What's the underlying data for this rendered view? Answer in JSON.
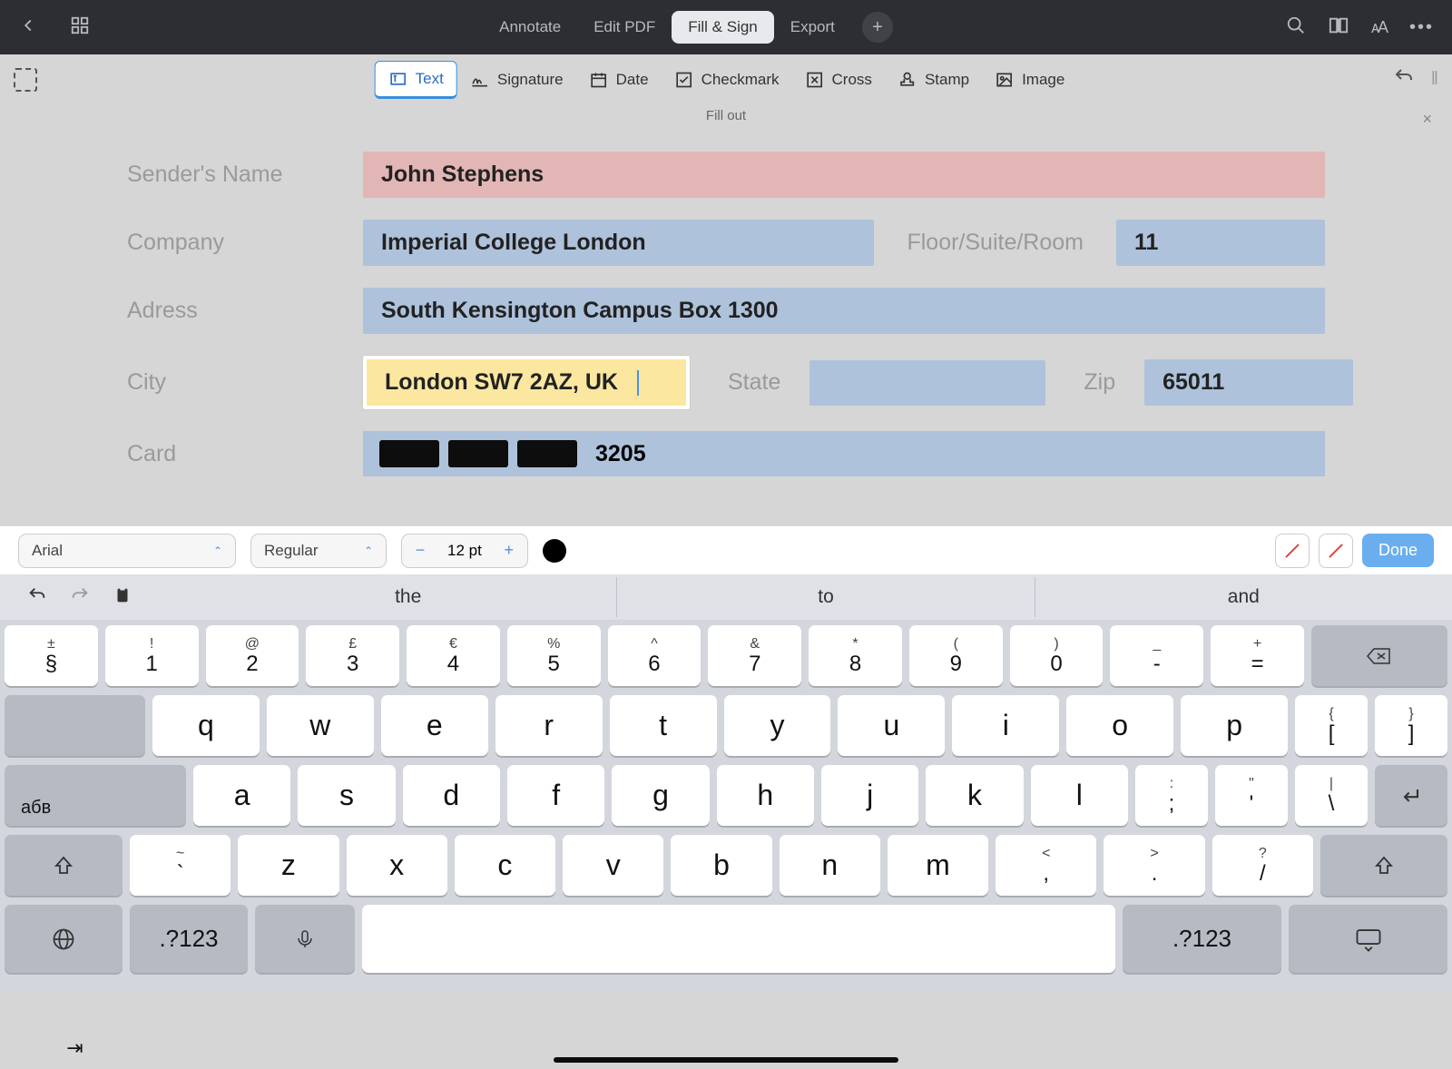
{
  "top": {
    "tabs": [
      "Annotate",
      "Edit PDF",
      "Fill & Sign",
      "Export"
    ],
    "activeTab": 2
  },
  "toolbar": {
    "tools": [
      {
        "icon": "text-icon",
        "label": "Text"
      },
      {
        "icon": "signature-icon",
        "label": "Signature"
      },
      {
        "icon": "date-icon",
        "label": "Date"
      },
      {
        "icon": "checkmark-icon",
        "label": "Checkmark"
      },
      {
        "icon": "cross-icon",
        "label": "Cross"
      },
      {
        "icon": "stamp-icon",
        "label": "Stamp"
      },
      {
        "icon": "image-icon",
        "label": "Image"
      }
    ],
    "activeTool": 0,
    "title": "Fill out"
  },
  "form": {
    "labels": {
      "sender": "Sender's Name",
      "company": "Company",
      "suite": "Floor/Suite/Room",
      "address": "Adress",
      "city": "City",
      "state": "State",
      "zip": "Zip",
      "card": "Card"
    },
    "values": {
      "sender": "John Stephens",
      "company": "Imperial College London",
      "suite": "11",
      "address": "South Kensington Campus Box 1300",
      "city": "London SW7 2AZ, UK",
      "state": "",
      "zip": "65011",
      "cardVisible": "3205"
    }
  },
  "format": {
    "font": "Arial",
    "weight": "Regular",
    "size": "12 pt",
    "done": "Done"
  },
  "suggestions": [
    "the",
    "to",
    "and"
  ],
  "keyboard": {
    "row1": [
      {
        "sup": "±",
        "main": "§"
      },
      {
        "sup": "!",
        "main": "1"
      },
      {
        "sup": "@",
        "main": "2"
      },
      {
        "sup": "£",
        "main": "3"
      },
      {
        "sup": "€",
        "main": "4"
      },
      {
        "sup": "%",
        "main": "5"
      },
      {
        "sup": "^",
        "main": "6"
      },
      {
        "sup": "&",
        "main": "7"
      },
      {
        "sup": "*",
        "main": "8"
      },
      {
        "sup": "(",
        "main": "9"
      },
      {
        "sup": ")",
        "main": "0"
      },
      {
        "sup": "_",
        "main": "-"
      },
      {
        "sup": "+",
        "main": "="
      }
    ],
    "row2": [
      "q",
      "w",
      "e",
      "r",
      "t",
      "y",
      "u",
      "i",
      "o",
      "p"
    ],
    "row2end": [
      {
        "sup": "{",
        "main": "["
      },
      {
        "sup": "}",
        "main": "]"
      }
    ],
    "row3": [
      "a",
      "s",
      "d",
      "f",
      "g",
      "h",
      "j",
      "k",
      "l"
    ],
    "row3end": [
      {
        "sup": ":",
        "main": ";"
      },
      {
        "sup": "\"",
        "main": "'"
      },
      {
        "sup": "|",
        "main": "\\"
      }
    ],
    "row4": [
      "z",
      "x",
      "c",
      "v",
      "b",
      "n",
      "m"
    ],
    "row4end": [
      {
        "sup": "<",
        "main": ","
      },
      {
        "sup": ">",
        "main": "."
      },
      {
        "sup": "?",
        "main": "/"
      }
    ],
    "row4tilde": {
      "sup": "~",
      "main": "`"
    },
    "abv": "абв",
    "num": ".?123"
  }
}
